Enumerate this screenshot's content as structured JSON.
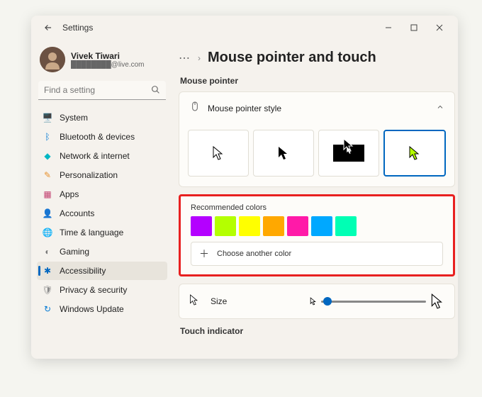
{
  "app_title": "Settings",
  "user": {
    "name": "Vivek Tiwari",
    "email": "████████@live.com"
  },
  "search": {
    "placeholder": "Find a setting"
  },
  "nav": [
    {
      "label": "System",
      "color": "#0078d4"
    },
    {
      "label": "Bluetooth & devices",
      "color": "#0078d4"
    },
    {
      "label": "Network & internet",
      "color": "#00b7c3"
    },
    {
      "label": "Personalization",
      "color": "#e8912d"
    },
    {
      "label": "Apps",
      "color": "#c23f6f"
    },
    {
      "label": "Accounts",
      "color": "#2aa876"
    },
    {
      "label": "Time & language",
      "color": "#a37a4b"
    },
    {
      "label": "Gaming",
      "color": "#7a7a7a"
    },
    {
      "label": "Accessibility",
      "color": "#0067c0"
    },
    {
      "label": "Privacy & security",
      "color": "#8a8a8a"
    },
    {
      "label": "Windows Update",
      "color": "#0078d4"
    }
  ],
  "page": {
    "title": "Mouse pointer and touch"
  },
  "section1": "Mouse pointer",
  "style_header": "Mouse pointer style",
  "colors_label": "Recommended colors",
  "swatches": [
    "#b400ff",
    "#b4ff00",
    "#ffff00",
    "#ffa800",
    "#ff1aa8",
    "#00a8ff",
    "#00ffb4"
  ],
  "choose_another": "Choose another color",
  "size_label": "Size",
  "section2": "Touch indicator",
  "accent": "#0067c0",
  "selected_pointer_color": "#b4ff00"
}
